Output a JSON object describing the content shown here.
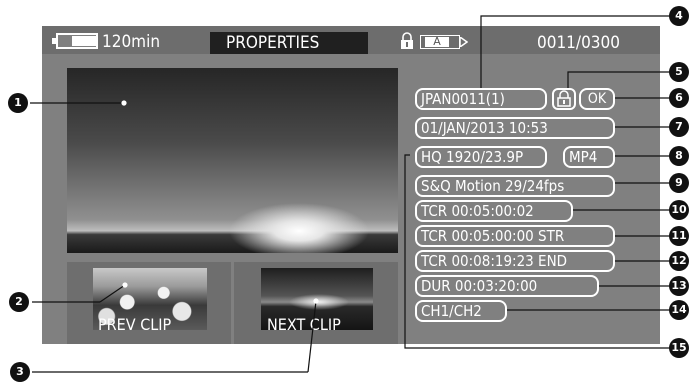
{
  "header": {
    "battery_time": "120min",
    "title": "PROPERTIES",
    "slot": "A",
    "clip_counter": "0011/0300"
  },
  "thumbnails": {
    "prev_label": "PREV CLIP",
    "next_label": "NEXT CLIP"
  },
  "properties": {
    "clip_name": "JPAN0011(1)",
    "status": "OK",
    "date_time": "01/JAN/2013 10:53",
    "video_format": "HQ 1920/23.9P",
    "file_format": "MP4",
    "sq_motion": "S&Q Motion 29/24fps",
    "tcr": "TCR 00:05:00:02",
    "tcr_start": "TCR 00:05:00:00 STR",
    "tcr_end": "TCR 00:08:19:23 END",
    "duration": "DUR 00:03:20:00",
    "audio_channels": "CH1/CH2"
  },
  "callouts": [
    "1",
    "2",
    "3",
    "4",
    "5",
    "6",
    "7",
    "8",
    "9",
    "10",
    "11",
    "12",
    "13",
    "14",
    "15"
  ],
  "colors": {
    "screen": "#808080",
    "header_bar": "#6d6d6d",
    "title_box": "#202020",
    "callout": "#111111"
  },
  "icons": [
    "battery-icon",
    "lock-icon",
    "media-slot-icon"
  ]
}
